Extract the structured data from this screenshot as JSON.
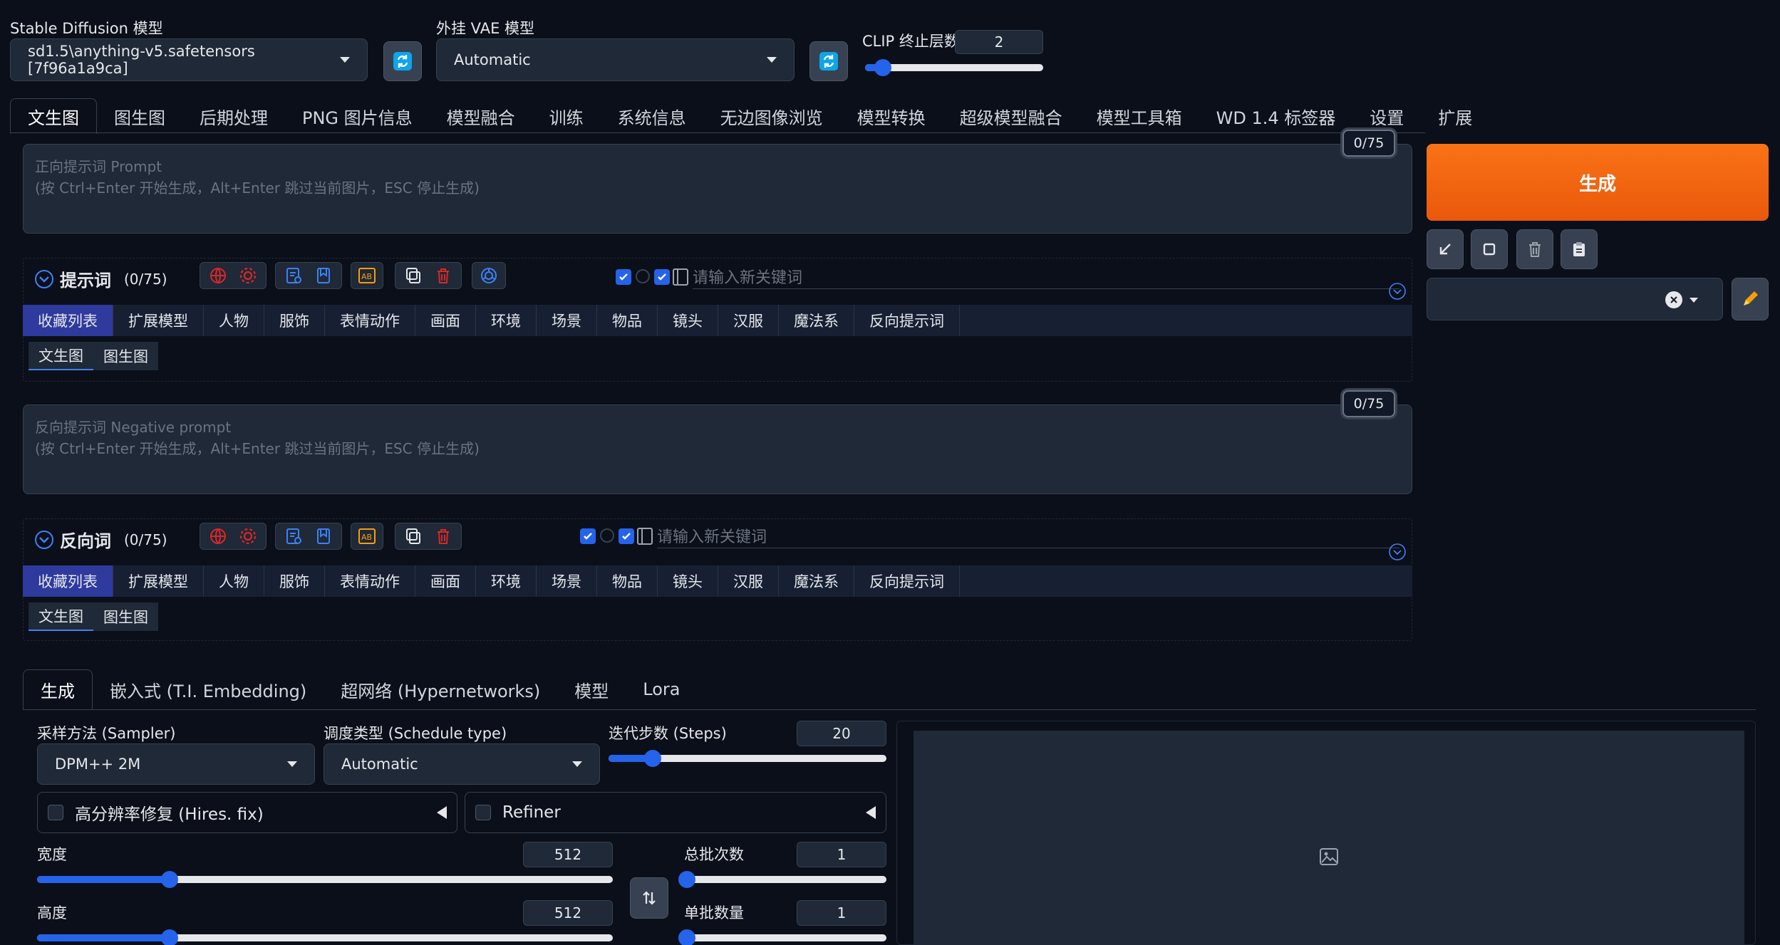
{
  "top": {
    "sd_model_label": "Stable Diffusion 模型",
    "sd_model_value": "sd1.5\\anything-v5.safetensors [7f96a1a9ca]",
    "vae_label": "外挂 VAE 模型",
    "vae_value": "Automatic",
    "clip_label": "CLIP 终止层数",
    "clip_value": "2",
    "clip_level": 0.1
  },
  "main_tabs": [
    "文生图",
    "图生图",
    "后期处理",
    "PNG 图片信息",
    "模型融合",
    "训练",
    "系统信息",
    "无边图像浏览",
    "模型转换",
    "超级模型融合",
    "模型工具箱",
    "WD 1.4 标签器",
    "设置",
    "扩展"
  ],
  "prompt": {
    "placeholder_line1": "正向提示词 Prompt",
    "placeholder_line2": "(按 Ctrl+Enter 开始生成，Alt+Enter 跳过当前图片，ESC 停止生成)",
    "counter": "0/75"
  },
  "prompt_panel": {
    "title": "提示词",
    "count": "(0/75)",
    "keyword_placeholder": "请输入新关键词"
  },
  "negative": {
    "placeholder_line1": "反向提示词 Negative prompt",
    "placeholder_line2": "(按 Ctrl+Enter 开始生成，Alt+Enter 跳过当前图片，ESC 停止生成)",
    "counter": "0/75"
  },
  "negative_panel": {
    "title": "反向词",
    "count": "(0/75)",
    "keyword_placeholder": "请输入新关键词"
  },
  "keyword_tabs": [
    "收藏列表",
    "扩展模型",
    "人物",
    "服饰",
    "表情动作",
    "画面",
    "环境",
    "场景",
    "物品",
    "镜头",
    "汉服",
    "魔法系",
    "反向提示词"
  ],
  "sub_tabs": [
    "文生图",
    "图生图"
  ],
  "generate_label": "生成",
  "settings_tabs": [
    "生成",
    "嵌入式 (T.I. Embedding)",
    "超网络 (Hypernetworks)",
    "模型",
    "Lora"
  ],
  "sampler": {
    "label": "采样方法 (Sampler)",
    "value": "DPM++ 2M"
  },
  "schedule": {
    "label": "调度类型 (Schedule type)",
    "value": "Automatic"
  },
  "steps": {
    "label": "迭代步数 (Steps)",
    "value": "20",
    "level": 0.16
  },
  "hires": {
    "label": "高分辨率修复 (Hires. fix)"
  },
  "refiner": {
    "label": "Refiner"
  },
  "width": {
    "label": "宽度",
    "value": "512",
    "level": 0.23
  },
  "height": {
    "label": "高度",
    "value": "512",
    "level": 0.23
  },
  "batch_count": {
    "label": "总批次数",
    "value": "1",
    "level": 0.0
  },
  "batch_size": {
    "label": "单批数量",
    "value": "1",
    "level": 0.0
  }
}
